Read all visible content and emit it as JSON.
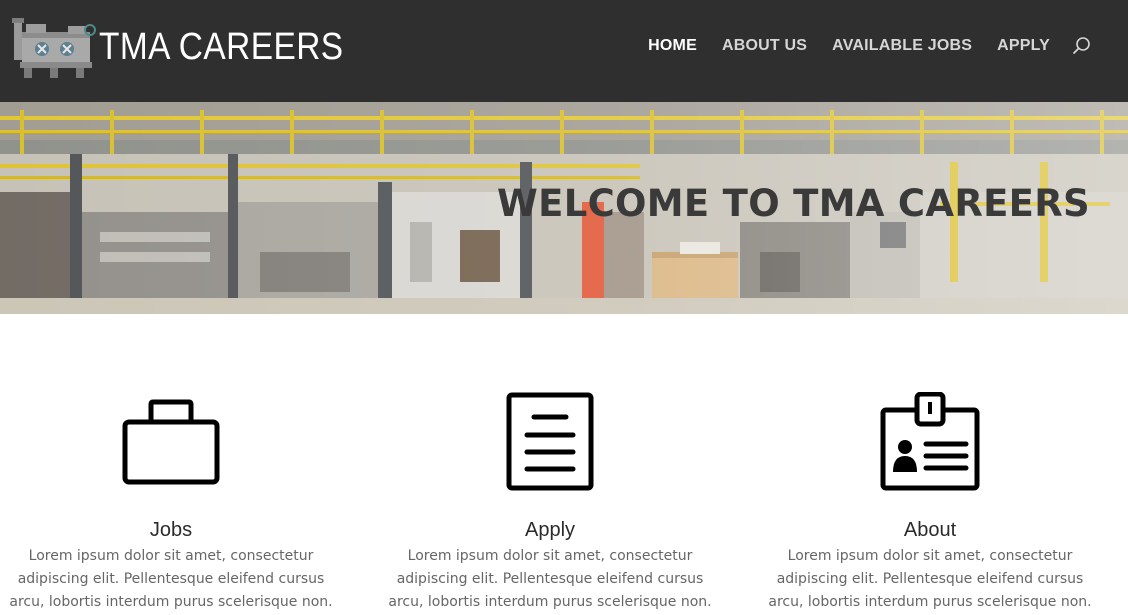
{
  "header": {
    "logo_text": "TMA CAREERS",
    "background": "#2f2f2f",
    "nav": [
      {
        "label": "HOME",
        "active": true
      },
      {
        "label": "ABOUT US",
        "active": false
      },
      {
        "label": "AVAILABLE JOBS",
        "active": false
      },
      {
        "label": "APPLY",
        "active": false
      }
    ],
    "search_icon": "search-icon"
  },
  "hero": {
    "title": "WELCOME TO TMA CAREERS",
    "background_subject": "factory-floor-photo"
  },
  "features": [
    {
      "icon": "briefcase-icon",
      "title": "Jobs",
      "text": "Lorem ipsum dolor sit amet, consectetur adipiscing elit. Pellentesque eleifend cursus arcu, lobortis interdum purus scelerisque non."
    },
    {
      "icon": "document-icon",
      "title": "Apply",
      "text": "Lorem ipsum dolor sit amet, consectetur adipiscing elit. Pellentesque eleifend cursus arcu, lobortis interdum purus scelerisque non."
    },
    {
      "icon": "id-badge-icon",
      "title": "About",
      "text": "Lorem ipsum dolor sit amet, consectetur adipiscing elit. Pellentesque eleifend cursus arcu, lobortis interdum purus scelerisque non."
    }
  ]
}
